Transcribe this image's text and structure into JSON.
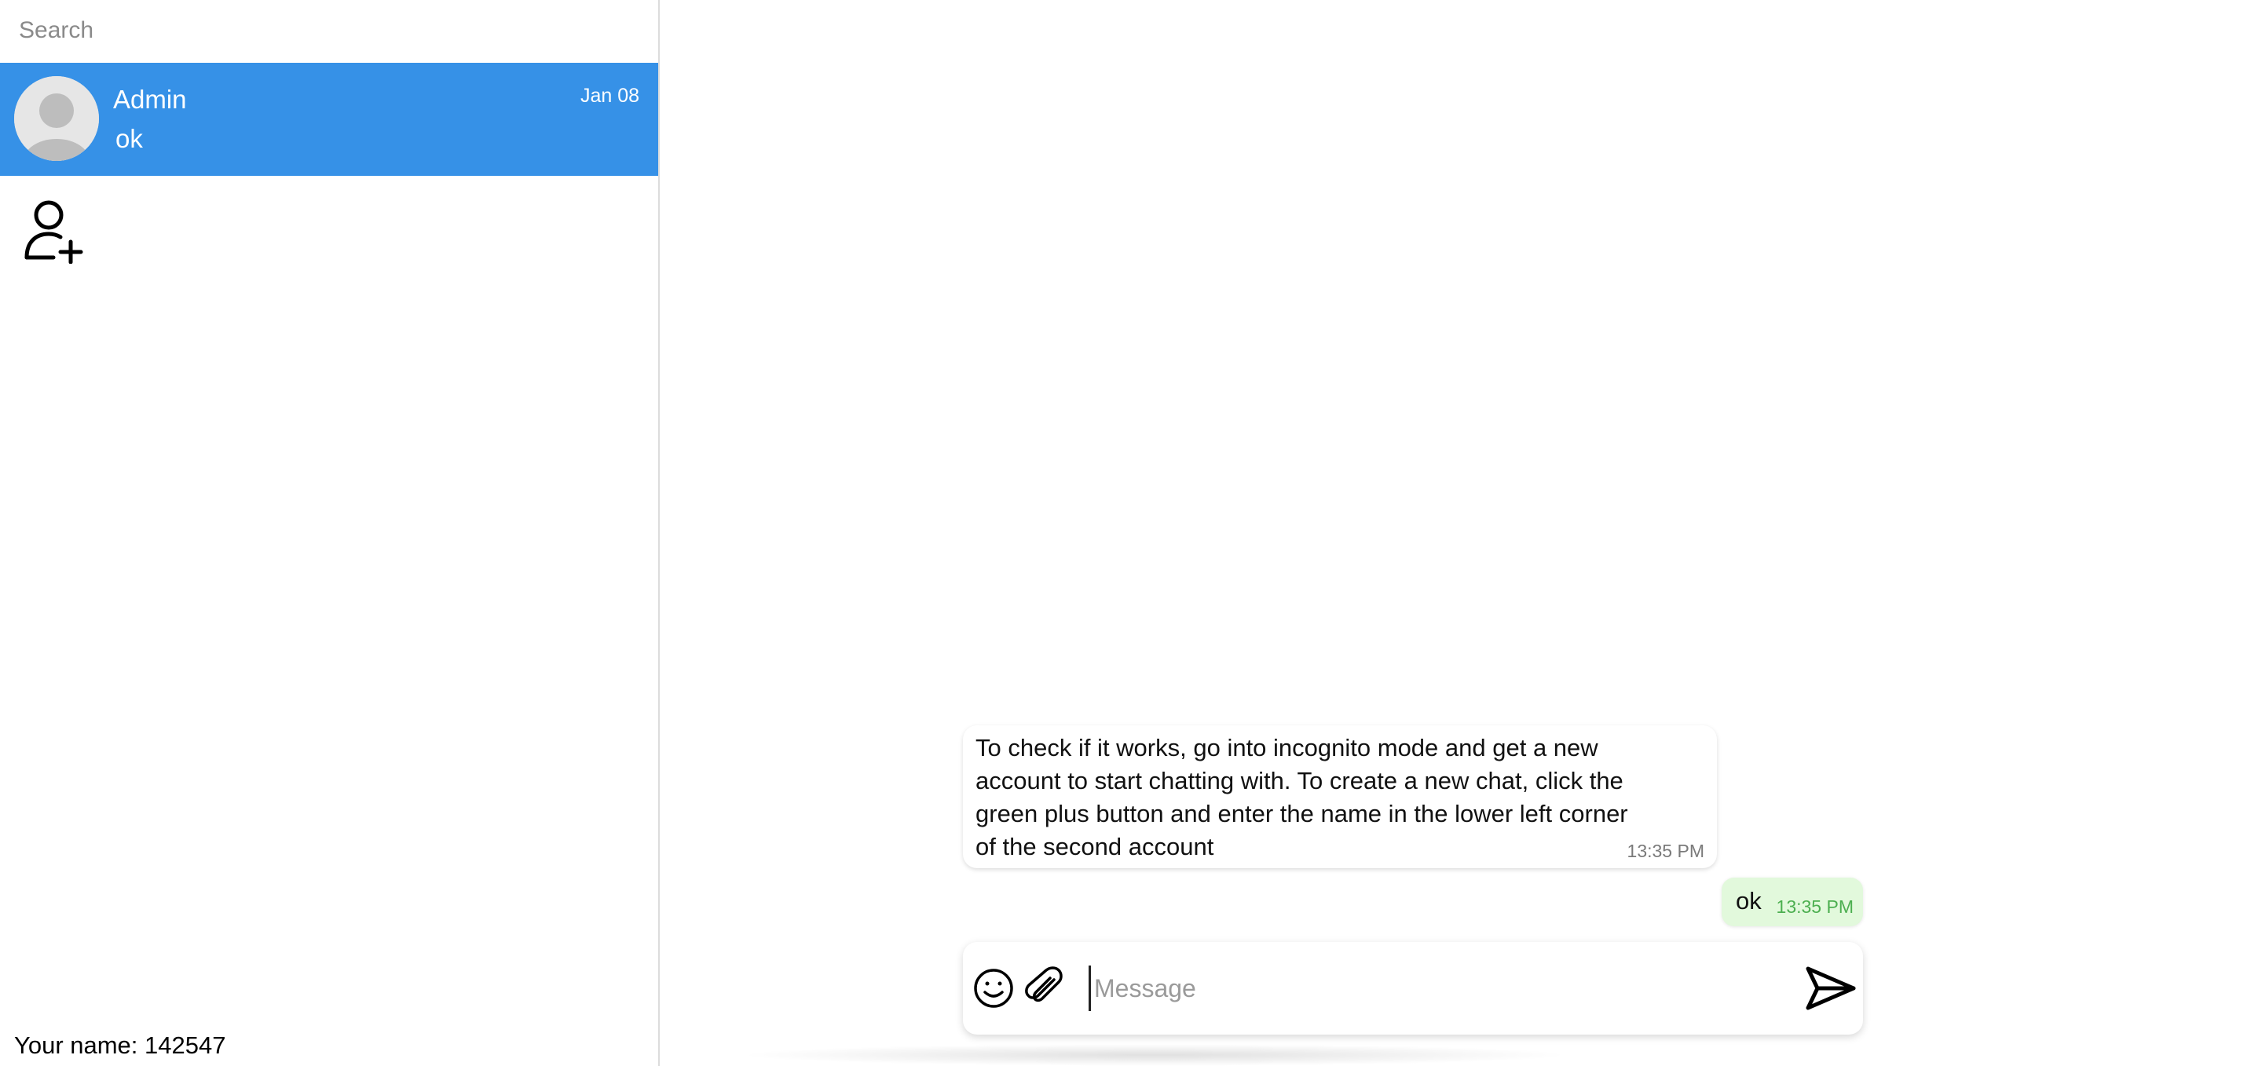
{
  "sidebar": {
    "search": {
      "placeholder": "Search",
      "value": ""
    },
    "chats": [
      {
        "name": "Admin",
        "date": "Jan 08",
        "last_message": "ok",
        "selected": true
      }
    ],
    "your_name_label": "Your name: 142547"
  },
  "conversation": {
    "messages": [
      {
        "direction": "incoming",
        "text": "To check if it works, go into incognito mode and get a new account to start chatting with. To create a new chat, click the green plus button and enter the name in the lower left corner of the second account",
        "time": "13:35 PM"
      },
      {
        "direction": "outgoing",
        "text": "ok",
        "time": "13:35 PM"
      }
    ],
    "composer": {
      "placeholder": "Message",
      "value": ""
    }
  },
  "icons": {
    "avatar": "user-avatar-icon",
    "add_user": "add-user-icon",
    "emoji": "emoji-icon",
    "attach": "paperclip-icon",
    "send": "send-icon"
  },
  "colors": {
    "accent": "#3691e7",
    "outgoing_bubble": "#e2f9dc",
    "outgoing_time": "#4caf50",
    "incoming_time": "#7a7a7a"
  }
}
